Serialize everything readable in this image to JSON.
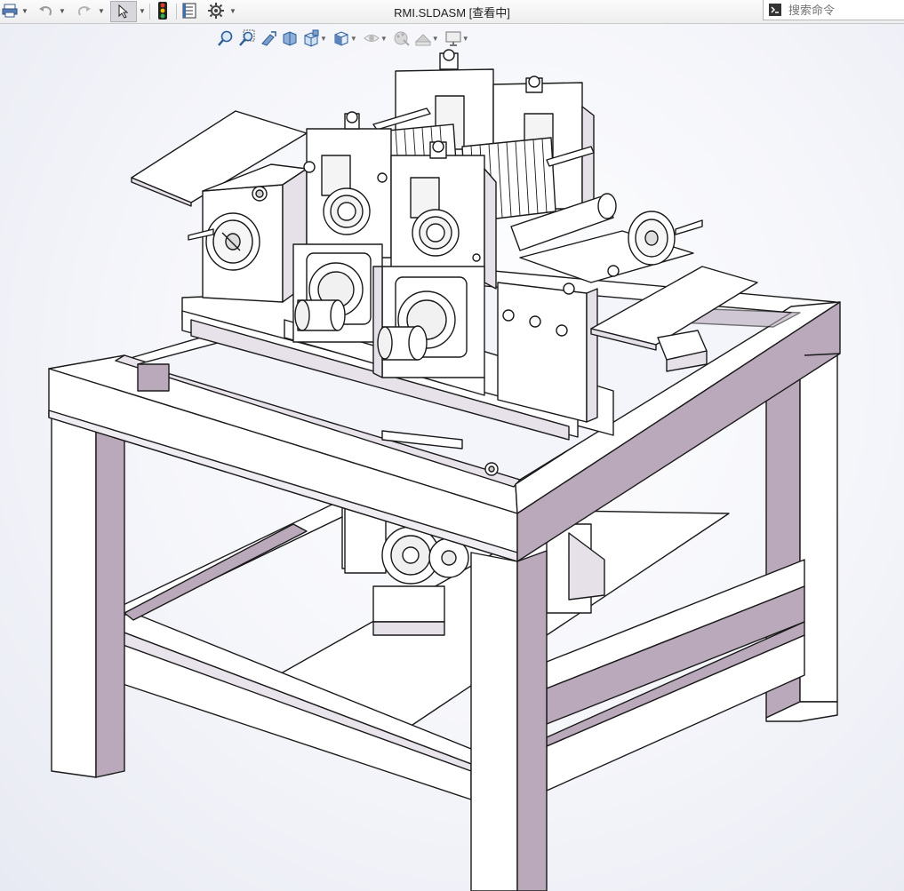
{
  "window": {
    "title": "RMI.SLDASM [查看中]"
  },
  "toolbar": {
    "items": [
      {
        "name": "print",
        "icon": "print-icon"
      },
      {
        "name": "undo",
        "icon": "undo-icon"
      },
      {
        "name": "redo",
        "icon": "redo-icon"
      },
      {
        "name": "select",
        "icon": "select-cursor-icon"
      },
      {
        "name": "rebuild",
        "icon": "traffic-light-icon"
      },
      {
        "name": "file-properties",
        "icon": "file-properties-icon"
      },
      {
        "name": "options",
        "icon": "gear-icon"
      }
    ]
  },
  "search": {
    "placeholder": "搜索命令",
    "icon": "command-prompt-icon"
  },
  "heads_up_toolbar": {
    "items": [
      {
        "name": "zoom-to-fit",
        "icon": "zoom-fit-icon"
      },
      {
        "name": "zoom-to-area",
        "icon": "zoom-area-icon"
      },
      {
        "name": "previous-view",
        "icon": "previous-view-icon"
      },
      {
        "name": "section-view",
        "icon": "section-view-icon"
      },
      {
        "name": "view-orientation",
        "icon": "view-orientation-icon"
      },
      {
        "name": "display-style",
        "icon": "display-style-icon"
      },
      {
        "name": "hide-show-items",
        "icon": "hide-show-icon"
      },
      {
        "name": "edit-appearance",
        "icon": "appearance-icon"
      },
      {
        "name": "apply-scene",
        "icon": "scene-icon"
      },
      {
        "name": "view-settings",
        "icon": "monitor-icon"
      }
    ]
  },
  "colors": {
    "frame_shade": "#b9a9bb",
    "frame_light": "#ffffff",
    "edge": "#1a1a1a",
    "background": "#eef0f6",
    "accent": "#2b6cb0"
  }
}
